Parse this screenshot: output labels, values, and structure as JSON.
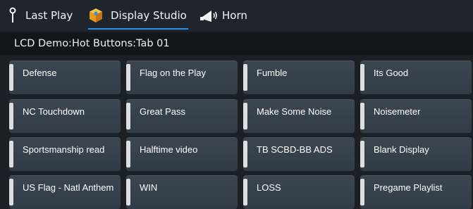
{
  "tabs": [
    {
      "label": "Last Play",
      "icon": "pin-icon",
      "active": false
    },
    {
      "label": "Display Studio",
      "icon": "cube-icon",
      "active": true
    },
    {
      "label": "Horn",
      "icon": "horn-icon",
      "active": false
    }
  ],
  "colors": {
    "background": "#1b2026",
    "tab_underline": "#2f8fe0",
    "button_face": "#36404a",
    "button_bar": "#dcdfe2"
  },
  "breadcrumb": "LCD Demo:Hot Buttons:Tab 01",
  "buttons": [
    [
      "Defense",
      "Flag on the Play",
      "Fumble",
      "Its Good"
    ],
    [
      "NC Touchdown",
      "Great Pass",
      "Make Some Noise",
      "Noisemeter"
    ],
    [
      "Sportsmanship read",
      "Halftime video",
      "TB SCBD-BB ADS",
      "Blank Display"
    ],
    [
      "US Flag - Natl Anthem",
      "WIN",
      "LOSS",
      "Pregame Playlist"
    ]
  ]
}
